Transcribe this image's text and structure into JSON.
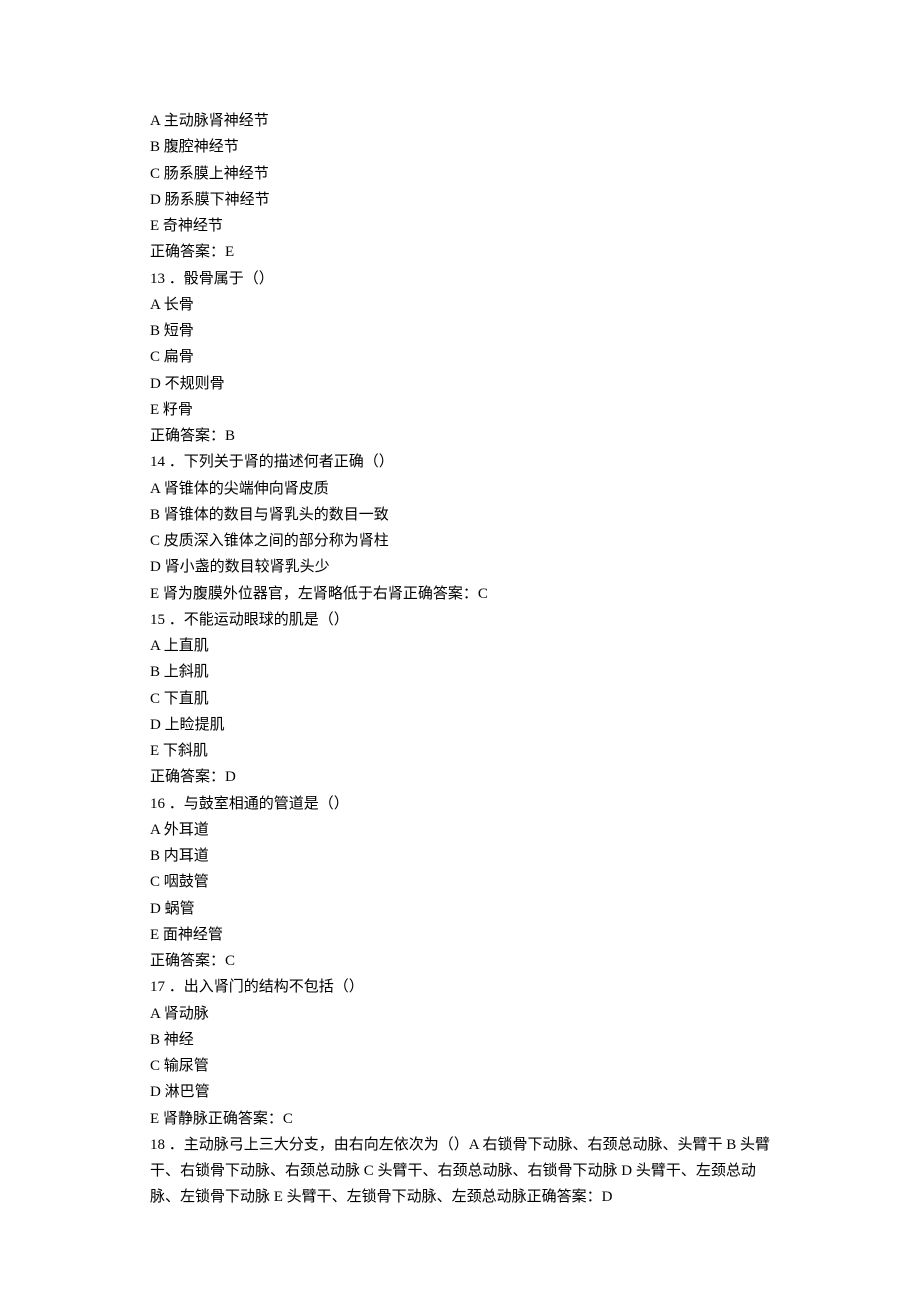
{
  "q12": {
    "A": "A 主动脉肾神经节",
    "B": "B 腹腔神经节",
    "C": "C 肠系膜上神经节",
    "D": "D 肠系膜下神经节",
    "E": "E 奇神经节",
    "ans": "正确答案：E"
  },
  "q13": {
    "stem": "13 ．骰骨属于（）",
    "A": "A 长骨",
    "B": "B 短骨",
    "C": "C 扁骨",
    "D": "D 不规则骨",
    "E": "E 籽骨",
    "ans": "正确答案：B"
  },
  "q14": {
    "stem": "14 ．下列关于肾的描述何者正确（）",
    "A": "A 肾锥体的尖端伸向肾皮质",
    "B": "B 肾锥体的数目与肾乳头的数目一致",
    "C": "C 皮质深入锥体之间的部分称为肾柱",
    "D": "D 肾小盏的数目较肾乳头少",
    "E": "E 肾为腹膜外位器官，左肾略低于右肾正确答案：C"
  },
  "q15": {
    "stem": "15 ．不能运动眼球的肌是（）",
    "A": "A 上直肌",
    "B": "B 上斜肌",
    "C": "C 下直肌",
    "D": "D 上睑提肌",
    "E": "E 下斜肌",
    "ans": "正确答案：D"
  },
  "q16": {
    "stem": "16 ．与鼓室相通的管道是（）",
    "A": "A 外耳道",
    "B": "B 内耳道",
    "C": "C 咽鼓管",
    "D": "D 蜗管",
    "E": "E 面神经管",
    "ans": "正确答案：C"
  },
  "q17": {
    "stem": "17 ．出入肾门的结构不包括（）",
    "A": "A 肾动脉",
    "B": "B 神经",
    "C": "C 输尿管",
    "D": "D 淋巴管",
    "E": "E 肾静脉正确答案：C"
  },
  "q18": {
    "stem": "18 ．主动脉弓上三大分支，由右向左依次为（）A 右锁骨下动脉、右颈总动脉、头臂干 B 头臂干、右锁骨下动脉、右颈总动脉 C 头臂干、右颈总动脉、右锁骨下动脉 D 头臂干、左颈总动脉、左锁骨下动脉 E 头臂干、左锁骨下动脉、左颈总动脉正确答案：D"
  }
}
